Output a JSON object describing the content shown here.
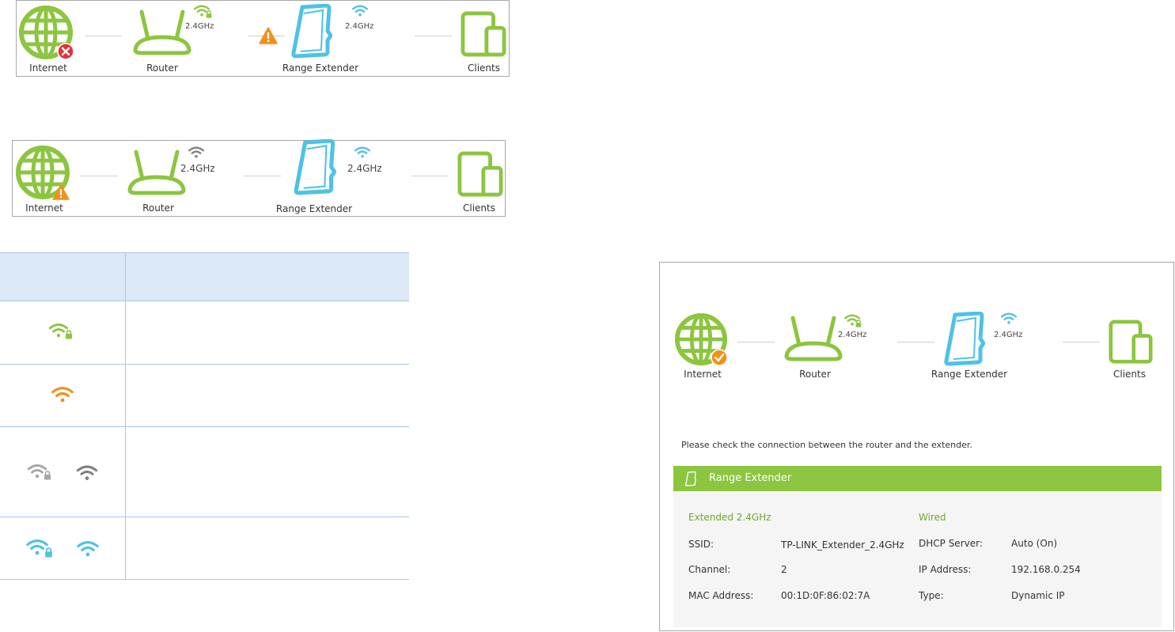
{
  "topology": {
    "labels": {
      "internet": "Internet",
      "router": "Router",
      "extender": "Range Extender",
      "clients": "Clients"
    },
    "frequency": "2.4GHz"
  },
  "message": "Please check the connection between the router and the extender.",
  "extender_panel": {
    "title": "Range Extender",
    "extended_heading": "Extended 2.4GHz",
    "wired_heading": "Wired",
    "ssid_label": "SSID:",
    "ssid_value": "TP-LINK_Extender_2.4GHz",
    "channel_label": "Channel:",
    "channel_value": "2",
    "mac_label": "MAC Address:",
    "mac_value": "00:1D:0F:86:02:7A",
    "dhcp_label": "DHCP Server:",
    "dhcp_value": "Auto (On)",
    "ip_label": "IP Address:",
    "ip_value": "192.168.0.254",
    "type_label": "Type:",
    "type_value": "Dynamic IP"
  },
  "colors": {
    "green": "#8cc540",
    "blue": "#4ec2e5",
    "orange": "#f39019",
    "gray": "#a6a6a6",
    "dark_gray": "#808080",
    "red": "#e0343a",
    "table_header": "#dbe8f6"
  },
  "icons": {
    "internet": "globe-icon",
    "router": "router-icon",
    "extender": "range-extender-icon",
    "clients": "devices-icon",
    "wifi": "wifi-icon",
    "lock": "lock-icon",
    "warning": "warning-icon",
    "error": "error-x-icon",
    "check": "check-icon"
  }
}
